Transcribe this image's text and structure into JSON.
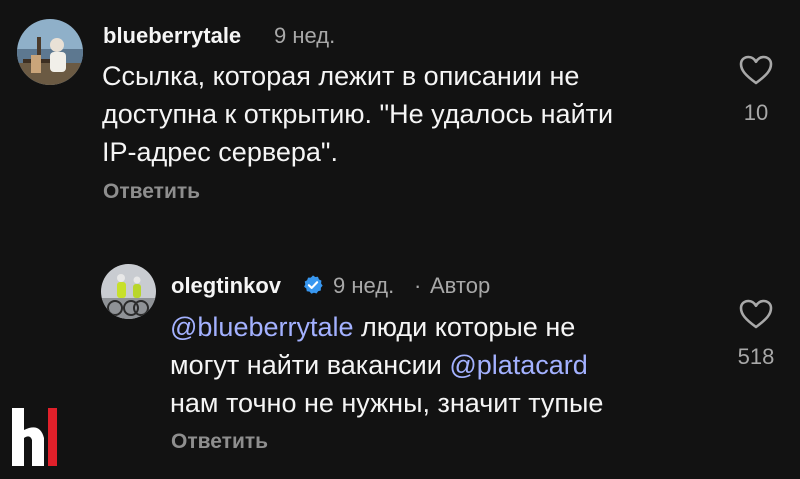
{
  "comments": [
    {
      "username": "blueberrytale",
      "time": "9 нед.",
      "text_lines": [
        "Ссылка, которая лежит в описании не",
        "доступна к открытию. \"Не удалось найти",
        "IP-адрес  сервера\"."
      ],
      "reply_label": "Ответить",
      "likes": "10"
    },
    {
      "username": "olegtinkov",
      "time": "9 нед.",
      "separator": "·",
      "author_label": "Автор",
      "mention_1": "@blueberrytale",
      "line_1_rest": " люди которые не",
      "line_2_start": "могут найти вакансии ",
      "mention_2": "@platacard",
      "line_3": "нам точно не нужны, значит тупые",
      "reply_label": "Ответить",
      "likes": "518"
    }
  ],
  "colors": {
    "background": "#121212",
    "mention": "#a3b1ff",
    "secondary_text": "#a8a8a8",
    "verified": "#3897f0",
    "logo_accent": "#e0202a"
  },
  "icons": {
    "like": "heart-outline-icon",
    "verified": "verified-badge-icon",
    "logo": "brand-logo"
  }
}
